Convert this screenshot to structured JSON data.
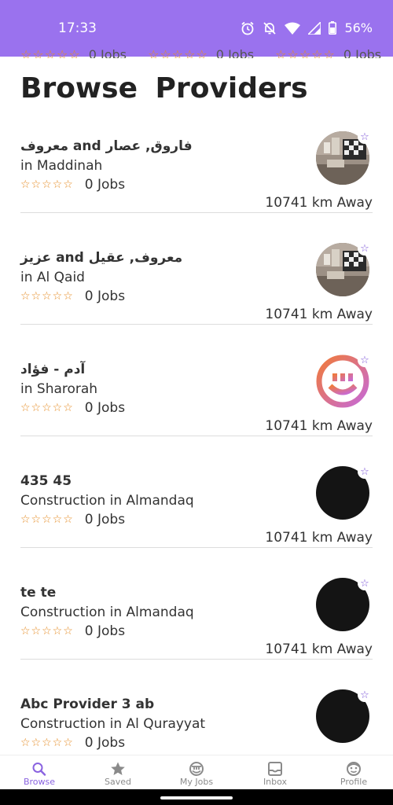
{
  "status_bar": {
    "time": "17:33",
    "battery": "56%"
  },
  "partial_row": [
    {
      "stars": "☆☆☆☆☆",
      "jobs": "0 Jobs"
    },
    {
      "stars": "☆☆☆☆☆",
      "jobs": "0 Jobs"
    },
    {
      "stars": "☆☆☆☆☆",
      "jobs": "0 Jobs"
    }
  ],
  "page_title": "Browse Providers",
  "providers": [
    {
      "name": "معروف and فاروق, عصار",
      "location": " in Maddinah",
      "stars": "☆☆☆☆☆",
      "jobs": "0 Jobs",
      "distance": "10741 km Away",
      "avatar": "photo",
      "favorite": "☆"
    },
    {
      "name": "عزيز and معروف, عقيل",
      "location": " in Al Qaid",
      "stars": "☆☆☆☆☆",
      "jobs": "0 Jobs",
      "distance": "10741 km Away",
      "avatar": "photo",
      "favorite": "☆"
    },
    {
      "name": "آدم - فؤاد",
      "location": " in Sharorah",
      "stars": "☆☆☆☆☆",
      "jobs": "0 Jobs",
      "distance": "10741 km Away",
      "avatar": "logo",
      "favorite": "☆"
    },
    {
      "name": "435 45",
      "location": "Construction in Almandaq",
      "stars": "☆☆☆☆☆",
      "jobs": "0 Jobs",
      "distance": "10741 km Away",
      "avatar": "black",
      "favorite": "☆"
    },
    {
      "name": "te te",
      "location": "Construction in Almandaq",
      "stars": "☆☆☆☆☆",
      "jobs": "0 Jobs",
      "distance": "10741 km Away",
      "avatar": "black",
      "favorite": "☆"
    },
    {
      "name": "Abc Provider 3 ab",
      "location": "Construction in Al Qurayyat",
      "stars": "☆☆☆☆☆",
      "jobs": "0 Jobs",
      "distance": "",
      "avatar": "black",
      "favorite": "☆"
    }
  ],
  "bottom_nav": [
    {
      "label": "Browse",
      "icon": "search-icon",
      "active": true
    },
    {
      "label": "Saved",
      "icon": "star-icon",
      "active": false
    },
    {
      "label": "My Jobs",
      "icon": "jobs-icon",
      "active": false
    },
    {
      "label": "Inbox",
      "icon": "inbox-icon",
      "active": false
    },
    {
      "label": "Profile",
      "icon": "profile-icon",
      "active": false
    }
  ],
  "colors": {
    "accent": "#9a72ee",
    "nav_active": "#8a63e0",
    "star": "#e58b23",
    "favorite_star": "#7c55d8"
  }
}
